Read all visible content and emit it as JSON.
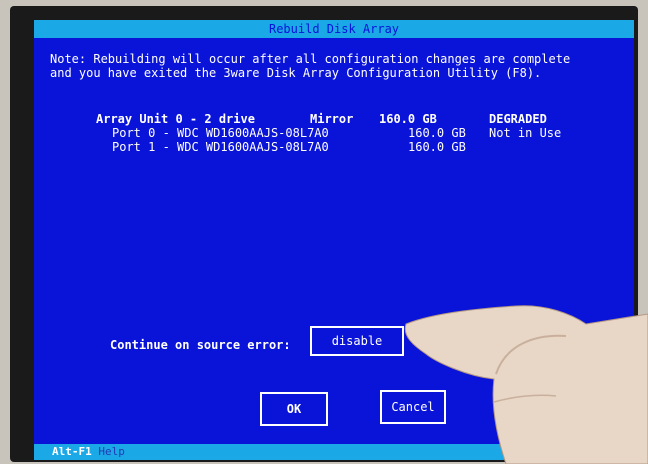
{
  "window": {
    "title": "Rebuild Disk Array"
  },
  "note": {
    "line1": "Note: Rebuilding will occur after all configuration changes are complete",
    "line2": "and you have exited the 3ware Disk Array Configuration Utility (F8)."
  },
  "array": {
    "unit": "Array Unit 0 - 2 drive",
    "type": "Mirror",
    "size": "160.0 GB",
    "status": "DEGRADED"
  },
  "ports": [
    {
      "name": "Port 0 - WDC WD1600AAJS-08L7A0",
      "size": "160.0 GB",
      "status": "Not in Use"
    },
    {
      "name": "Port 1 - WDC WD1600AAJS-08L7A0",
      "size": "160.0 GB",
      "status": ""
    }
  ],
  "options": {
    "continue_label": "Continue on source error:",
    "continue_value": "disable"
  },
  "buttons": {
    "ok": "OK",
    "cancel": "Cancel"
  },
  "statusbar": {
    "key": "Alt-F1",
    "text": "Help"
  },
  "colors": {
    "screen_bg": "#0a14d8",
    "accent_bar": "#1aa8e6",
    "text": "#ffffff"
  }
}
